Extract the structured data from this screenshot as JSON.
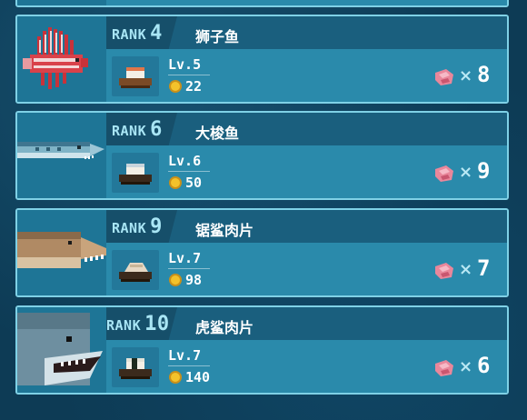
{
  "rank_prefix": "RANK",
  "times_symbol": "×",
  "entries": [
    {
      "rank": "4",
      "fish": "狮子鱼",
      "level": "Lv.5",
      "price": "22",
      "quantity": "8",
      "fish_icon": "lionfish-icon"
    },
    {
      "rank": "6",
      "fish": "大梭鱼",
      "level": "Lv.6",
      "price": "50",
      "quantity": "9",
      "fish_icon": "barracuda-icon"
    },
    {
      "rank": "9",
      "fish": "锯鲨肉片",
      "level": "Lv.7",
      "price": "98",
      "quantity": "7",
      "fish_icon": "sawshark-icon"
    },
    {
      "rank": "10",
      "fish": "虎鲨肉片",
      "level": "Lv.7",
      "price": "140",
      "quantity": "6",
      "fish_icon": "tiger-shark-icon"
    }
  ]
}
